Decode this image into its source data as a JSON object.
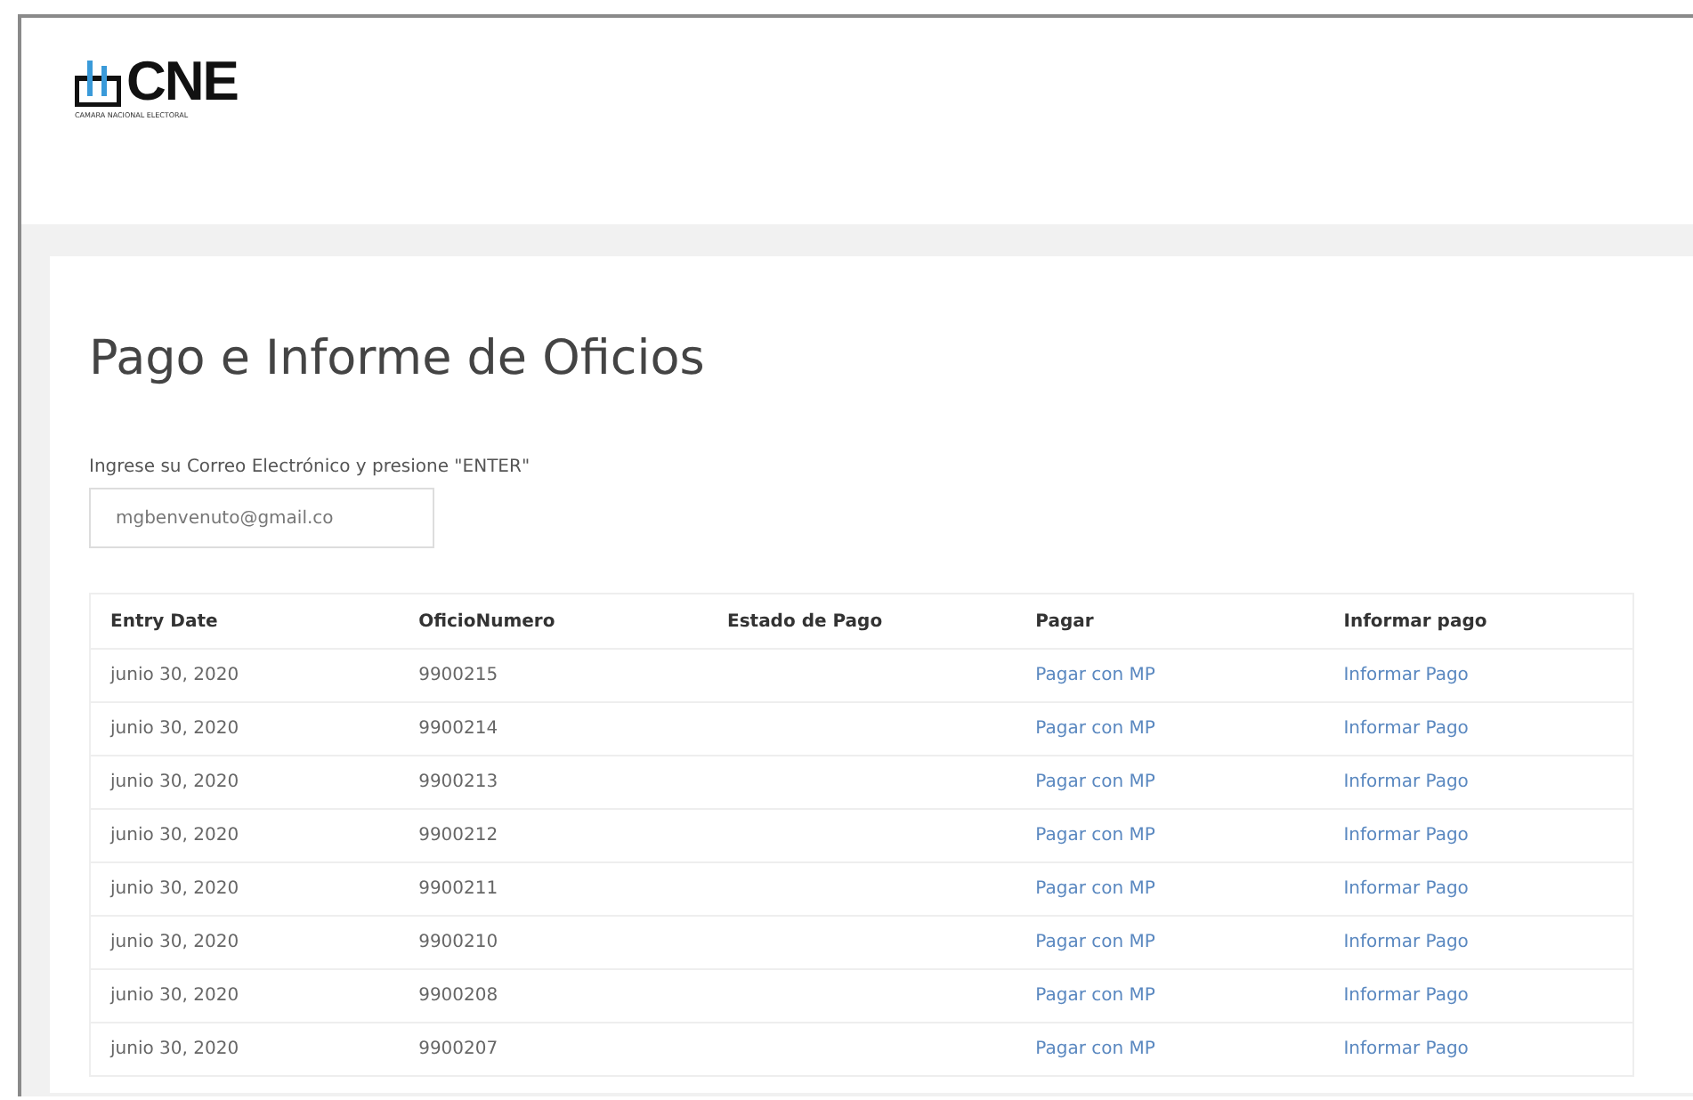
{
  "logo": {
    "name": "CNE",
    "subtitle": "CAMARA NACIONAL ELECTORAL"
  },
  "title": "Pago e Informe de Oficios",
  "email": {
    "label": "Ingrese su Correo Electrónico y presione \"ENTER\"",
    "value": "mgbenvenuto@gmail.co"
  },
  "table": {
    "columns": [
      "Entry Date",
      "OficioNumero",
      "Estado de Pago",
      "Pagar",
      "Informar pago"
    ],
    "rows": [
      {
        "date": "junio 30, 2020",
        "number": "9900215",
        "pay": "Pagar con MP",
        "report": "Informar Pago"
      },
      {
        "date": "junio 30, 2020",
        "number": "9900214",
        "pay": "Pagar con MP",
        "report": "Informar Pago"
      },
      {
        "date": "junio 30, 2020",
        "number": "9900213",
        "pay": "Pagar con MP",
        "report": "Informar Pago"
      },
      {
        "date": "junio 30, 2020",
        "number": "9900212",
        "pay": "Pagar con MP",
        "report": "Informar Pago"
      },
      {
        "date": "junio 30, 2020",
        "number": "9900211",
        "pay": "Pagar con MP",
        "report": "Informar Pago"
      },
      {
        "date": "junio 30, 2020",
        "number": "9900210",
        "pay": "Pagar con MP",
        "report": "Informar Pago"
      },
      {
        "date": "junio 30, 2020",
        "number": "9900208",
        "pay": "Pagar con MP",
        "report": "Informar Pago"
      },
      {
        "date": "junio 30, 2020",
        "number": "9900207",
        "pay": "Pagar con MP",
        "report": "Informar Pago"
      }
    ]
  }
}
